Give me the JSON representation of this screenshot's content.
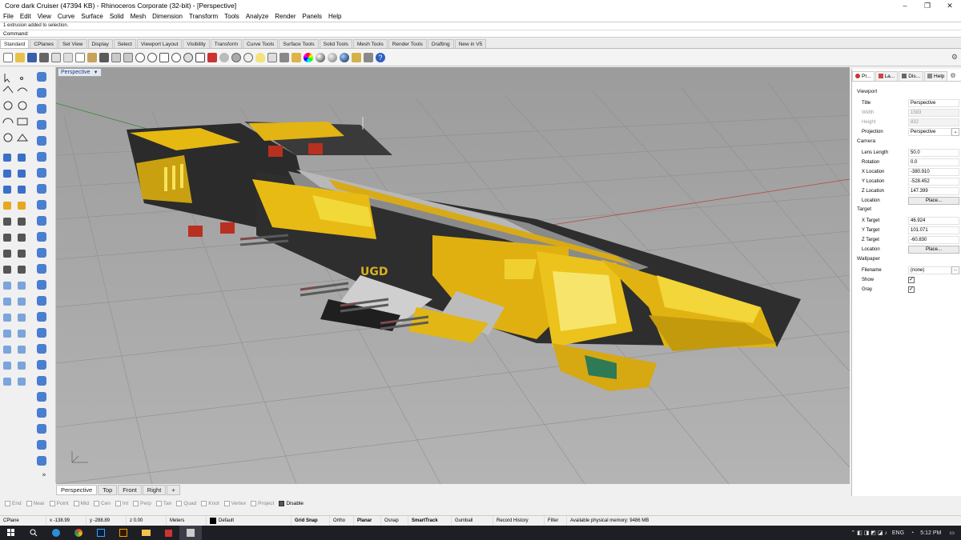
{
  "window": {
    "title": "Core dark Cruiser (47394 KB) - Rhinoceros Corporate (32-bit) - [Perspective]",
    "minimize": "–",
    "maximize": "❐",
    "close": "✕"
  },
  "menu": [
    "File",
    "Edit",
    "View",
    "Curve",
    "Surface",
    "Solid",
    "Mesh",
    "Dimension",
    "Transform",
    "Tools",
    "Analyze",
    "Render",
    "Panels",
    "Help"
  ],
  "command": {
    "history": "1 extrusion added to selection.",
    "label": "Command:",
    "value": ""
  },
  "toolbar_tabs": [
    "Standard",
    "CPlanes",
    "Set View",
    "Display",
    "Select",
    "Viewport Layout",
    "Visibility",
    "Transform",
    "Curve Tools",
    "Surface Tools",
    "Solid Tools",
    "Mesh Tools",
    "Render Tools",
    "Drafting",
    "New in V5"
  ],
  "toolbar_icons": [
    "new-icon",
    "open-icon",
    "save-icon",
    "print-icon",
    "import-icon",
    "cut-icon",
    "copy-icon",
    "paste-icon",
    "undo-icon",
    "pan-hand-icon",
    "move-icon",
    "zoom-icon",
    "zoom-window-icon",
    "zoom-extents-icon",
    "zoom-selected-icon",
    "rotate-view-icon",
    "four-views-icon",
    "named-cplane-icon",
    "render-sphere-icon",
    "hide-icon",
    "show-icon",
    "light-icon",
    "properties-icon",
    "lock-icon",
    "layer-icon",
    "color-wheel-icon",
    "rendered-sphere-icon",
    "shaded-sphere-icon",
    "render-icon",
    "materials-icon",
    "options-icon",
    "help-icon"
  ],
  "viewport": {
    "label": "Perspective",
    "ship_text": "UGD"
  },
  "viewport_tabs": [
    "Perspective",
    "Top",
    "Front",
    "Right",
    "+"
  ],
  "panel": {
    "tabs": [
      {
        "label": "Pr...",
        "icon": "properties-icon"
      },
      {
        "label": "La...",
        "icon": "layers-icon"
      },
      {
        "label": "Dis...",
        "icon": "display-icon"
      },
      {
        "label": "Help",
        "icon": "help-icon"
      }
    ],
    "viewport_section": "Viewport",
    "title_k": "Title",
    "title_v": "Perspective",
    "width_k": "Width",
    "width_v": "1583",
    "height_k": "Height",
    "height_v": "832",
    "projection_k": "Projection",
    "projection_v": "Perspective",
    "camera_section": "Camera",
    "lens_k": "Lens Length",
    "lens_v": "50.0",
    "rotation_k": "Rotation",
    "rotation_v": "0.0",
    "xloc_k": "X Location",
    "xloc_v": "-380.910",
    "yloc_k": "Y Location",
    "yloc_v": "-528.452",
    "zloc_k": "Z Location",
    "zloc_v": "147.399",
    "cam_location_k": "Location",
    "cam_place": "Place...",
    "target_section": "Target",
    "xtgt_k": "X Target",
    "xtgt_v": "46.924",
    "ytgt_k": "Y Target",
    "ytgt_v": "101.071",
    "ztgt_k": "Z Target",
    "ztgt_v": "-60.830",
    "tgt_location_k": "Location",
    "tgt_place": "Place...",
    "wallpaper_section": "Wallpaper",
    "filename_k": "Filename",
    "filename_v": "(none)",
    "show_k": "Show",
    "gray_k": "Gray",
    "browse": "..."
  },
  "osnaps": [
    {
      "label": "End",
      "checked": false
    },
    {
      "label": "Near",
      "checked": false
    },
    {
      "label": "Point",
      "checked": false
    },
    {
      "label": "Mid",
      "checked": false
    },
    {
      "label": "Cen",
      "checked": false
    },
    {
      "label": "Int",
      "checked": false
    },
    {
      "label": "Perp",
      "checked": false
    },
    {
      "label": "Tan",
      "checked": false
    },
    {
      "label": "Quad",
      "checked": false
    },
    {
      "label": "Knot",
      "checked": false
    },
    {
      "label": "Vertex",
      "checked": false
    },
    {
      "label": "Project",
      "checked": false
    },
    {
      "label": "Disable",
      "checked": true
    }
  ],
  "status": {
    "cplane": "CPlane",
    "x": "x -138.99",
    "y": "y -288.89",
    "z": "z 0.00",
    "units": "Meters",
    "layer": "Default",
    "grid_snap": "Grid Snap",
    "ortho": "Ortho",
    "planar": "Planar",
    "osnap": "Osnap",
    "smarttrack": "SmartTrack",
    "gumball": "Gumball",
    "record_history": "Record History",
    "filter": "Filter",
    "memory": "Available physical memory: 9486 MB"
  },
  "taskbar": {
    "lang": "ENG",
    "time": "5:12 PM"
  },
  "colors": {
    "viewport_bg": "#a7a7a7",
    "ship_yellow": "#e5b812",
    "ship_dark": "#2a2a2a",
    "accent_blue": "#1f3d8a"
  }
}
